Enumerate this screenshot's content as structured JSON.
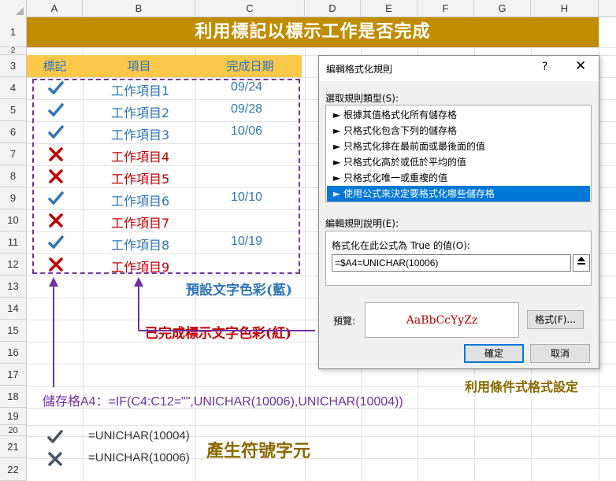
{
  "columns": [
    "A",
    "B",
    "C",
    "D",
    "E",
    "F",
    "G",
    "H"
  ],
  "rows": [
    "1",
    "2",
    "3",
    "4",
    "5",
    "6",
    "7",
    "8",
    "9",
    "10",
    "11",
    "12",
    "13",
    "14",
    "15",
    "16",
    "17",
    "18",
    "19",
    "20",
    "21",
    "22"
  ],
  "title": "利用標記以標示工作是否完成",
  "table": {
    "headers": [
      "標記",
      "項目",
      "完成日期"
    ],
    "items": [
      {
        "done": true,
        "task": "工作項目1",
        "date": "09/24"
      },
      {
        "done": true,
        "task": "工作項目2",
        "date": "09/28"
      },
      {
        "done": true,
        "task": "工作項目3",
        "date": "10/06"
      },
      {
        "done": false,
        "task": "工作項目4",
        "date": ""
      },
      {
        "done": false,
        "task": "工作項目5",
        "date": ""
      },
      {
        "done": true,
        "task": "工作項目6",
        "date": "10/10"
      },
      {
        "done": false,
        "task": "工作項目7",
        "date": ""
      },
      {
        "done": true,
        "task": "工作項目8",
        "date": "10/19"
      },
      {
        "done": false,
        "task": "工作項目9",
        "date": ""
      }
    ]
  },
  "annotations": {
    "default_color": "預設文字色彩(藍)",
    "completed_color": "已完成標示文字色彩(紅)",
    "cond_format": "利用條件式格式設定",
    "produce_symbol": "產生符號字元"
  },
  "formula_note": "儲存格A4：=IF(C4:C12=\"\",UNICHAR(10006),UNICHAR(10004))",
  "symbols": [
    {
      "icon": "check-icon",
      "formula": "=UNICHAR(10004)"
    },
    {
      "icon": "cross-icon",
      "formula": "=UNICHAR(10006)"
    }
  ],
  "dialog": {
    "title": "編輯格式化規則",
    "help": "?",
    "close": "✕",
    "select_rule_type_label": "選取規則類型(S):",
    "rule_types": [
      "► 根據其值格式化所有儲存格",
      "► 只格式化包含下列的儲存格",
      "► 只格式化排在最前面或最後面的值",
      "► 只格式化高於或低於平均的值",
      "► 只格式化唯一或重複的值",
      "► 使用公式來決定要格式化哪些儲存格"
    ],
    "selected_rule_index": 5,
    "edit_description_label": "編輯規則說明(E):",
    "formula_label": "格式化在此公式為 True 的值(O):",
    "formula_value": "=$A4=UNICHAR(10006)",
    "preview_label": "預覽:",
    "preview_text": "AaBbCcYyZz",
    "format_button": "格式(F)...",
    "ok_button": "確定",
    "cancel_button": "取消"
  },
  "colors": {
    "title_bg": "#c08c00",
    "header_band": "#fbc84a",
    "blue_text": "#2e75b6",
    "red_text": "#c00000",
    "purple": "#7030a0",
    "selected_rule": "#0078d7"
  }
}
